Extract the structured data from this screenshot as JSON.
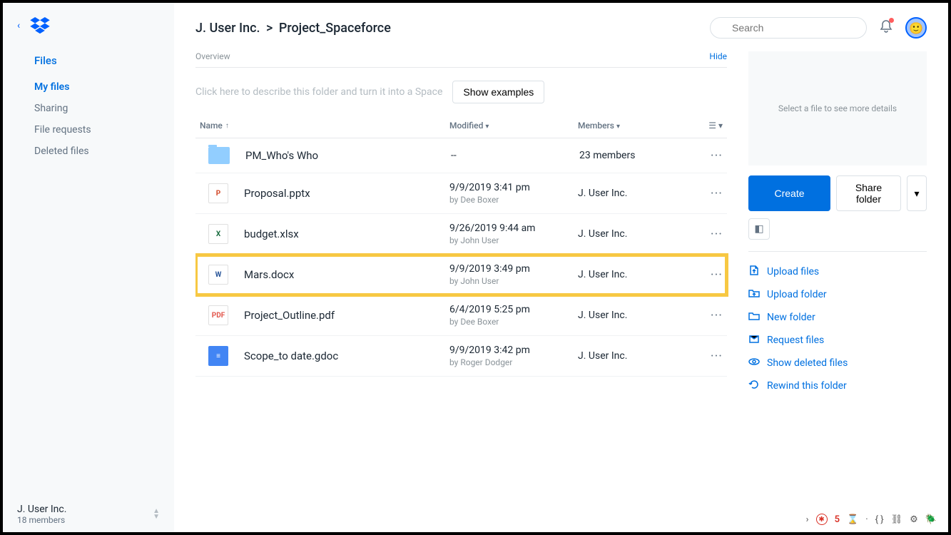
{
  "sidebar": {
    "section_title": "Files",
    "items": [
      {
        "label": "My files",
        "active": true
      },
      {
        "label": "Sharing",
        "active": false
      },
      {
        "label": "File requests",
        "active": false
      },
      {
        "label": "Deleted files",
        "active": false
      }
    ],
    "team_name": "J. User Inc.",
    "team_members": "18 members"
  },
  "header": {
    "breadcrumb_root": "J. User Inc.",
    "breadcrumb_current": "Project_Spaceforce",
    "search_placeholder": "Search"
  },
  "overview": {
    "label": "Overview",
    "hide_label": "Hide",
    "space_prompt": "Click here to describe this folder and turn it into a Space",
    "examples_button": "Show examples"
  },
  "columns": {
    "name": "Name",
    "modified": "Modified",
    "members": "Members"
  },
  "files": [
    {
      "icon": "folder",
      "name": "PM_Who's Who",
      "modified": "--",
      "by": "",
      "members": "23 members",
      "highlighted": false
    },
    {
      "icon": "pptx",
      "name": "Proposal.pptx",
      "modified": "9/9/2019 3:41 pm",
      "by": "by Dee Boxer",
      "members": "J. User Inc.",
      "highlighted": false
    },
    {
      "icon": "xlsx",
      "name": "budget.xlsx",
      "modified": "9/26/2019 9:44 am",
      "by": "by John User",
      "members": "J. User Inc.",
      "highlighted": false
    },
    {
      "icon": "docx",
      "name": "Mars.docx",
      "modified": "9/9/2019 3:49 pm",
      "by": "by John User",
      "members": "J. User Inc.",
      "highlighted": true
    },
    {
      "icon": "pdf",
      "name": "Project_Outline.pdf",
      "modified": "6/4/2019 5:25 pm",
      "by": "by Dee Boxer",
      "members": "J. User Inc.",
      "highlighted": false
    },
    {
      "icon": "gdoc",
      "name": "Scope_to date.gdoc",
      "modified": "9/9/2019 3:42 pm",
      "by": "by Roger Dodger",
      "members": "J. User Inc.",
      "highlighted": false
    }
  ],
  "details": {
    "preview_placeholder": "Select a file to see more details",
    "create_label": "Create",
    "share_label": "Share folder",
    "actions": [
      {
        "icon": "upload-file",
        "label": "Upload files"
      },
      {
        "icon": "upload-folder",
        "label": "Upload folder"
      },
      {
        "icon": "new-folder",
        "label": "New folder"
      },
      {
        "icon": "request",
        "label": "Request files"
      },
      {
        "icon": "show-deleted",
        "label": "Show deleted files"
      },
      {
        "icon": "rewind",
        "label": "Rewind this folder"
      }
    ]
  },
  "devtools": {
    "count": "5"
  }
}
